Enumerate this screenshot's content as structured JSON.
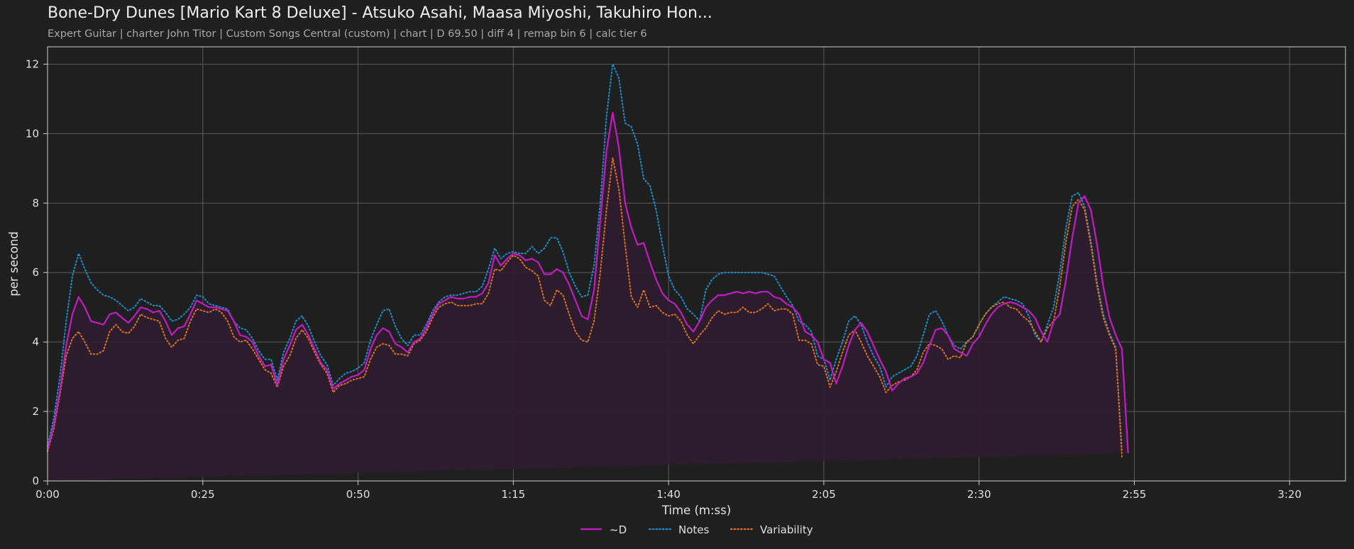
{
  "header": {
    "title": "Bone-Dry Dunes [Mario Kart 8 Deluxe] - Atsuko Asahi, Maasa Miyoshi, Takuhiro Hon...",
    "subtitle": "Expert Guitar  |  charter John Titor  |  Custom Songs Central (custom)  |  chart  |  D 69.50  |  diff 4  |  remap bin 6  |  calc tier 6"
  },
  "colors": {
    "background": "#1f1f1f",
    "d_line": "#c21bc2",
    "notes_line": "#1f8fce",
    "variability_line": "#e0731f",
    "fill": "#2e1c2e",
    "grid": "#5a5a5a"
  },
  "chart_data": {
    "type": "line",
    "title": "",
    "xlabel": "Time (m:ss)",
    "ylabel": "per second",
    "xlim": [
      0,
      209
    ],
    "ylim": [
      0,
      12.5
    ],
    "xticks": [
      0,
      25,
      50,
      75,
      100,
      125,
      150,
      175,
      200
    ],
    "xtick_labels": [
      "0:00",
      "0:25",
      "0:50",
      "1:15",
      "1:40",
      "2:05",
      "2:30",
      "2:55",
      "3:20"
    ],
    "yticks": [
      0,
      2,
      4,
      6,
      8,
      10,
      12
    ],
    "grid": true,
    "legend_position": "bottom-center",
    "x": [
      0,
      1,
      2,
      3,
      4,
      5,
      6,
      7,
      8,
      9,
      10,
      11,
      12,
      13,
      14,
      15,
      16,
      17,
      18,
      19,
      20,
      21,
      22,
      23,
      24,
      25,
      26,
      27,
      28,
      29,
      30,
      31,
      32,
      33,
      34,
      35,
      36,
      37,
      38,
      39,
      40,
      41,
      42,
      43,
      44,
      45,
      46,
      47,
      48,
      49,
      50,
      51,
      52,
      53,
      54,
      55,
      56,
      57,
      58,
      59,
      60,
      61,
      62,
      63,
      64,
      65,
      66,
      67,
      68,
      69,
      70,
      71,
      72,
      73,
      74,
      75,
      76,
      77,
      78,
      79,
      80,
      81,
      82,
      83,
      84,
      85,
      86,
      87,
      88,
      89,
      90,
      91,
      92,
      93,
      94,
      95,
      96,
      97,
      98,
      99,
      100,
      101,
      102,
      103,
      104,
      105,
      106,
      107,
      108,
      109,
      110,
      111,
      112,
      113,
      114,
      115,
      116,
      117,
      118,
      119,
      120,
      121,
      122,
      123,
      124,
      125,
      126,
      127,
      128,
      129,
      130,
      131,
      132,
      133,
      134,
      135,
      136,
      137,
      138,
      139,
      140,
      141,
      142,
      143,
      144,
      145,
      146,
      147,
      148,
      149,
      150,
      151,
      152,
      153,
      154,
      155,
      156,
      157,
      158,
      159,
      160,
      161,
      162,
      163,
      164,
      165,
      166,
      167,
      168,
      169,
      170,
      171,
      172,
      173,
      174,
      175,
      176,
      177,
      178,
      179,
      180,
      181,
      182,
      183,
      184,
      185,
      186,
      187,
      188,
      189,
      190,
      191,
      192,
      193,
      194,
      195,
      196,
      197,
      198,
      199,
      200,
      201,
      202,
      203,
      204,
      205,
      206,
      207,
      208,
      209
    ],
    "series": [
      {
        "name": "~D",
        "style": "solid",
        "color": "#c21bc2",
        "values": [
          0.9,
          1.6,
          2.6,
          3.9,
          4.8,
          5.3,
          5.0,
          4.6,
          4.55,
          4.5,
          4.8,
          4.85,
          4.7,
          4.55,
          4.75,
          5.0,
          4.95,
          4.85,
          4.9,
          4.6,
          4.2,
          4.4,
          4.45,
          4.8,
          5.2,
          5.1,
          5.0,
          5.0,
          4.95,
          4.9,
          4.6,
          4.2,
          4.15,
          4.0,
          3.6,
          3.3,
          3.35,
          2.75,
          3.5,
          3.9,
          4.35,
          4.5,
          4.2,
          3.8,
          3.4,
          3.2,
          2.65,
          2.8,
          2.9,
          3.0,
          3.05,
          3.2,
          3.8,
          4.2,
          4.4,
          4.3,
          3.95,
          3.85,
          3.7,
          4.0,
          4.1,
          4.4,
          4.8,
          5.1,
          5.2,
          5.3,
          5.25,
          5.25,
          5.3,
          5.3,
          5.4,
          5.7,
          6.5,
          6.2,
          6.4,
          6.55,
          6.5,
          6.35,
          6.4,
          6.3,
          5.95,
          5.95,
          6.1,
          6.0,
          5.65,
          5.2,
          4.75,
          4.65,
          5.5,
          7.5,
          9.5,
          10.6,
          9.6,
          8.0,
          7.3,
          6.8,
          6.85,
          6.3,
          5.8,
          5.4,
          5.2,
          5.1,
          4.85,
          4.5,
          4.3,
          4.6,
          5.0,
          5.2,
          5.35,
          5.35,
          5.4,
          5.45,
          5.4,
          5.45,
          5.4,
          5.45,
          5.45,
          5.3,
          5.25,
          5.1,
          5.0,
          4.8,
          4.3,
          4.2,
          4.0,
          3.5,
          3.4,
          2.8,
          3.3,
          3.9,
          4.35,
          4.55,
          4.3,
          3.9,
          3.5,
          3.15,
          2.6,
          2.8,
          2.95,
          3.0,
          3.1,
          3.4,
          3.9,
          4.35,
          4.4,
          4.2,
          3.8,
          3.7,
          3.6,
          3.95,
          4.15,
          4.5,
          4.8,
          5.0,
          5.1,
          5.15,
          5.1,
          5.0,
          4.9,
          4.7,
          4.3,
          4.0,
          4.6,
          4.8,
          5.8,
          7.0,
          8.0,
          8.2,
          7.8,
          6.8,
          5.6,
          4.7,
          4.2,
          3.8,
          0.8
        ]
      },
      {
        "name": "Notes",
        "style": "dotted",
        "color": "#1f8fce",
        "values": [
          1.0,
          1.8,
          3.0,
          4.6,
          5.9,
          6.55,
          6.1,
          5.7,
          5.5,
          5.35,
          5.3,
          5.2,
          5.05,
          4.9,
          5.0,
          5.25,
          5.15,
          5.05,
          5.05,
          4.85,
          4.6,
          4.65,
          4.8,
          5.0,
          5.35,
          5.3,
          5.1,
          5.05,
          5.0,
          4.95,
          4.6,
          4.4,
          4.35,
          4.1,
          3.75,
          3.5,
          3.5,
          2.9,
          3.7,
          4.1,
          4.6,
          4.75,
          4.45,
          4.0,
          3.6,
          3.35,
          2.75,
          2.95,
          3.1,
          3.15,
          3.25,
          3.4,
          4.05,
          4.5,
          4.9,
          4.95,
          4.45,
          4.1,
          3.9,
          4.2,
          4.2,
          4.5,
          4.9,
          5.15,
          5.3,
          5.35,
          5.35,
          5.4,
          5.45,
          5.45,
          5.6,
          6.1,
          6.7,
          6.4,
          6.55,
          6.6,
          6.55,
          6.55,
          6.75,
          6.55,
          6.7,
          7.0,
          7.0,
          6.6,
          6.0,
          5.6,
          5.3,
          5.35,
          6.2,
          8.0,
          10.5,
          12.0,
          11.6,
          10.3,
          10.2,
          9.7,
          8.7,
          8.5,
          7.8,
          6.8,
          5.9,
          5.5,
          5.3,
          4.95,
          4.8,
          4.6,
          5.5,
          5.8,
          5.95,
          6.0,
          6.0,
          6.0,
          6.0,
          6.0,
          6.0,
          6.0,
          5.95,
          5.9,
          5.6,
          5.3,
          5.05,
          4.6,
          4.5,
          4.3,
          3.6,
          3.5,
          2.9,
          3.5,
          4.0,
          4.6,
          4.75,
          4.5,
          4.0,
          3.6,
          3.3,
          2.7,
          3.0,
          3.1,
          3.2,
          3.3,
          3.6,
          4.2,
          4.8,
          4.9,
          4.6,
          4.2,
          3.9,
          3.8,
          4.0,
          4.15,
          4.5,
          4.8,
          5.0,
          5.15,
          5.3,
          5.25,
          5.2,
          5.1,
          4.75,
          4.2,
          4.0,
          4.5,
          5.0,
          6.0,
          7.3,
          8.2,
          8.3,
          7.9,
          6.9,
          5.7,
          4.8,
          4.25,
          3.85,
          0.85
        ]
      },
      {
        "name": "Variability",
        "style": "dotted",
        "color": "#e0731f",
        "values": [
          0.85,
          1.5,
          2.5,
          3.6,
          4.1,
          4.3,
          4.0,
          3.65,
          3.65,
          3.75,
          4.3,
          4.5,
          4.3,
          4.25,
          4.45,
          4.8,
          4.7,
          4.65,
          4.6,
          4.1,
          3.85,
          4.05,
          4.1,
          4.6,
          4.95,
          4.9,
          4.85,
          4.95,
          4.85,
          4.6,
          4.15,
          4.0,
          4.05,
          3.8,
          3.5,
          3.2,
          3.1,
          2.7,
          3.3,
          3.6,
          4.1,
          4.35,
          4.1,
          3.7,
          3.35,
          3.1,
          2.55,
          2.75,
          2.8,
          2.9,
          2.95,
          3.0,
          3.5,
          3.85,
          3.95,
          3.9,
          3.65,
          3.65,
          3.6,
          3.95,
          4.05,
          4.3,
          4.7,
          5.0,
          5.1,
          5.15,
          5.05,
          5.05,
          5.05,
          5.1,
          5.1,
          5.4,
          6.1,
          6.05,
          6.3,
          6.5,
          6.4,
          6.15,
          6.05,
          5.9,
          5.2,
          5.05,
          5.5,
          5.35,
          4.8,
          4.3,
          4.05,
          4.0,
          4.6,
          6.0,
          7.8,
          9.3,
          8.4,
          6.8,
          5.3,
          5.0,
          5.5,
          5.0,
          5.05,
          4.85,
          4.75,
          4.8,
          4.6,
          4.2,
          3.95,
          4.2,
          4.4,
          4.7,
          4.9,
          4.8,
          4.85,
          4.85,
          5.0,
          4.85,
          4.85,
          4.95,
          5.1,
          4.9,
          4.95,
          4.95,
          4.8,
          4.05,
          4.05,
          3.95,
          3.35,
          3.3,
          2.7,
          3.15,
          3.7,
          4.2,
          4.35,
          4.0,
          3.6,
          3.3,
          3.0,
          2.55,
          2.75,
          2.85,
          2.9,
          3.0,
          3.2,
          3.7,
          3.95,
          3.9,
          3.8,
          3.5,
          3.6,
          3.55,
          4.0,
          4.15,
          4.5,
          4.8,
          5.0,
          5.1,
          5.15,
          5.0,
          4.95,
          4.75,
          4.6,
          4.3,
          4.0,
          4.4,
          4.6,
          5.6,
          6.9,
          7.9,
          8.1,
          7.8,
          6.8,
          5.6,
          4.7,
          4.2,
          3.8,
          0.7
        ]
      }
    ]
  }
}
